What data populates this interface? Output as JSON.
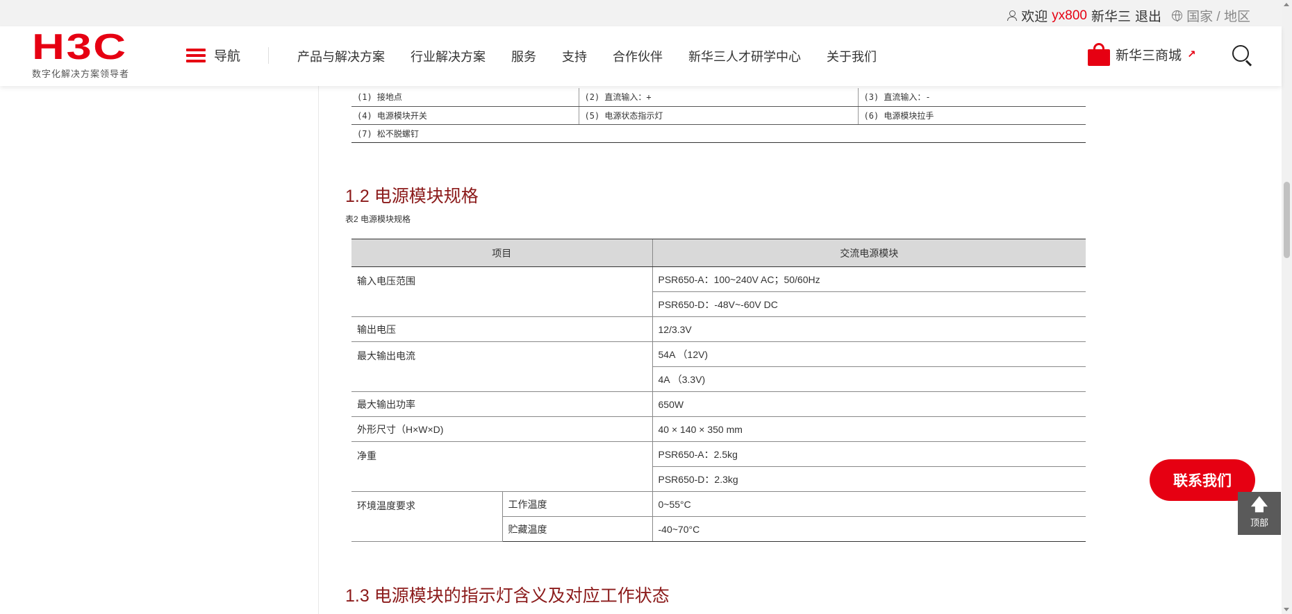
{
  "topbar": {
    "welcome": "欢迎",
    "username": "yx800",
    "org": "新华三",
    "logout": "退出",
    "region": "国家 / 地区"
  },
  "header": {
    "logo_text": "H3C",
    "slogan": "数字化解决方案领导者",
    "nav_toggle": "导航",
    "menu": [
      "产品与解决方案",
      "行业解决方案",
      "服务",
      "支持",
      "合作伙伴",
      "新华三人才研学中心",
      "关于我们"
    ],
    "mall": "新华三商城",
    "icons": {
      "user": "person-icon",
      "region": "globe-icon",
      "menu": "hamburger-icon",
      "mall": "shopping-bag-icon",
      "external": "external-link-icon",
      "search": "search-icon"
    },
    "accent_color": "#e60012"
  },
  "figure_legend": {
    "rows": [
      [
        "(1) 接地点",
        "(2) 直流输入：+",
        "(3) 直流输入：-"
      ],
      [
        "(4) 电源模块开关",
        "(5) 电源状态指示灯",
        "(6) 电源模块拉手"
      ],
      [
        "(7) 松不脱螺钉"
      ]
    ]
  },
  "section_1_2": {
    "title": "1.2 电源模块规格",
    "table_caption": "表2  电源模块规格",
    "headers": [
      "项目",
      "交流电源模块"
    ],
    "rows": {
      "input_voltage": {
        "label": "输入电压范围",
        "values": [
          "PSR650-A：100~240V AC；50/60Hz",
          "PSR650-D：-48V~-60V DC"
        ]
      },
      "output_voltage": {
        "label": "输出电压",
        "value": "12/3.3V"
      },
      "max_current": {
        "label": "最大输出电流",
        "values": [
          "54A （12V)",
          "4A （3.3V)"
        ]
      },
      "max_power": {
        "label": "最大输出功率",
        "value": "650W"
      },
      "dimensions": {
        "label": "外形尺寸（H×W×D)",
        "value": "40 × 140 × 350 mm"
      },
      "net_weight": {
        "label": "净重",
        "values": [
          "PSR650-A：2.5kg",
          "PSR650-D：2.3kg"
        ]
      },
      "env_temp": {
        "label": "环境温度要求",
        "sub": [
          {
            "label": "工作温度",
            "value": "0~55°C"
          },
          {
            "label": "贮藏温度",
            "value": "-40~70°C"
          }
        ]
      }
    }
  },
  "section_1_3": {
    "title": "1.3 电源模块的指示灯含义及对应工作状态"
  },
  "floating": {
    "contact": "联系我们",
    "top": "顶部",
    "top_arrow": "🡅"
  },
  "colors": {
    "heading": "#8b1a1a",
    "table_header_bg": "#d9d9d9",
    "button_red": "#e60012",
    "totop_bg": "#5a5a5a"
  }
}
